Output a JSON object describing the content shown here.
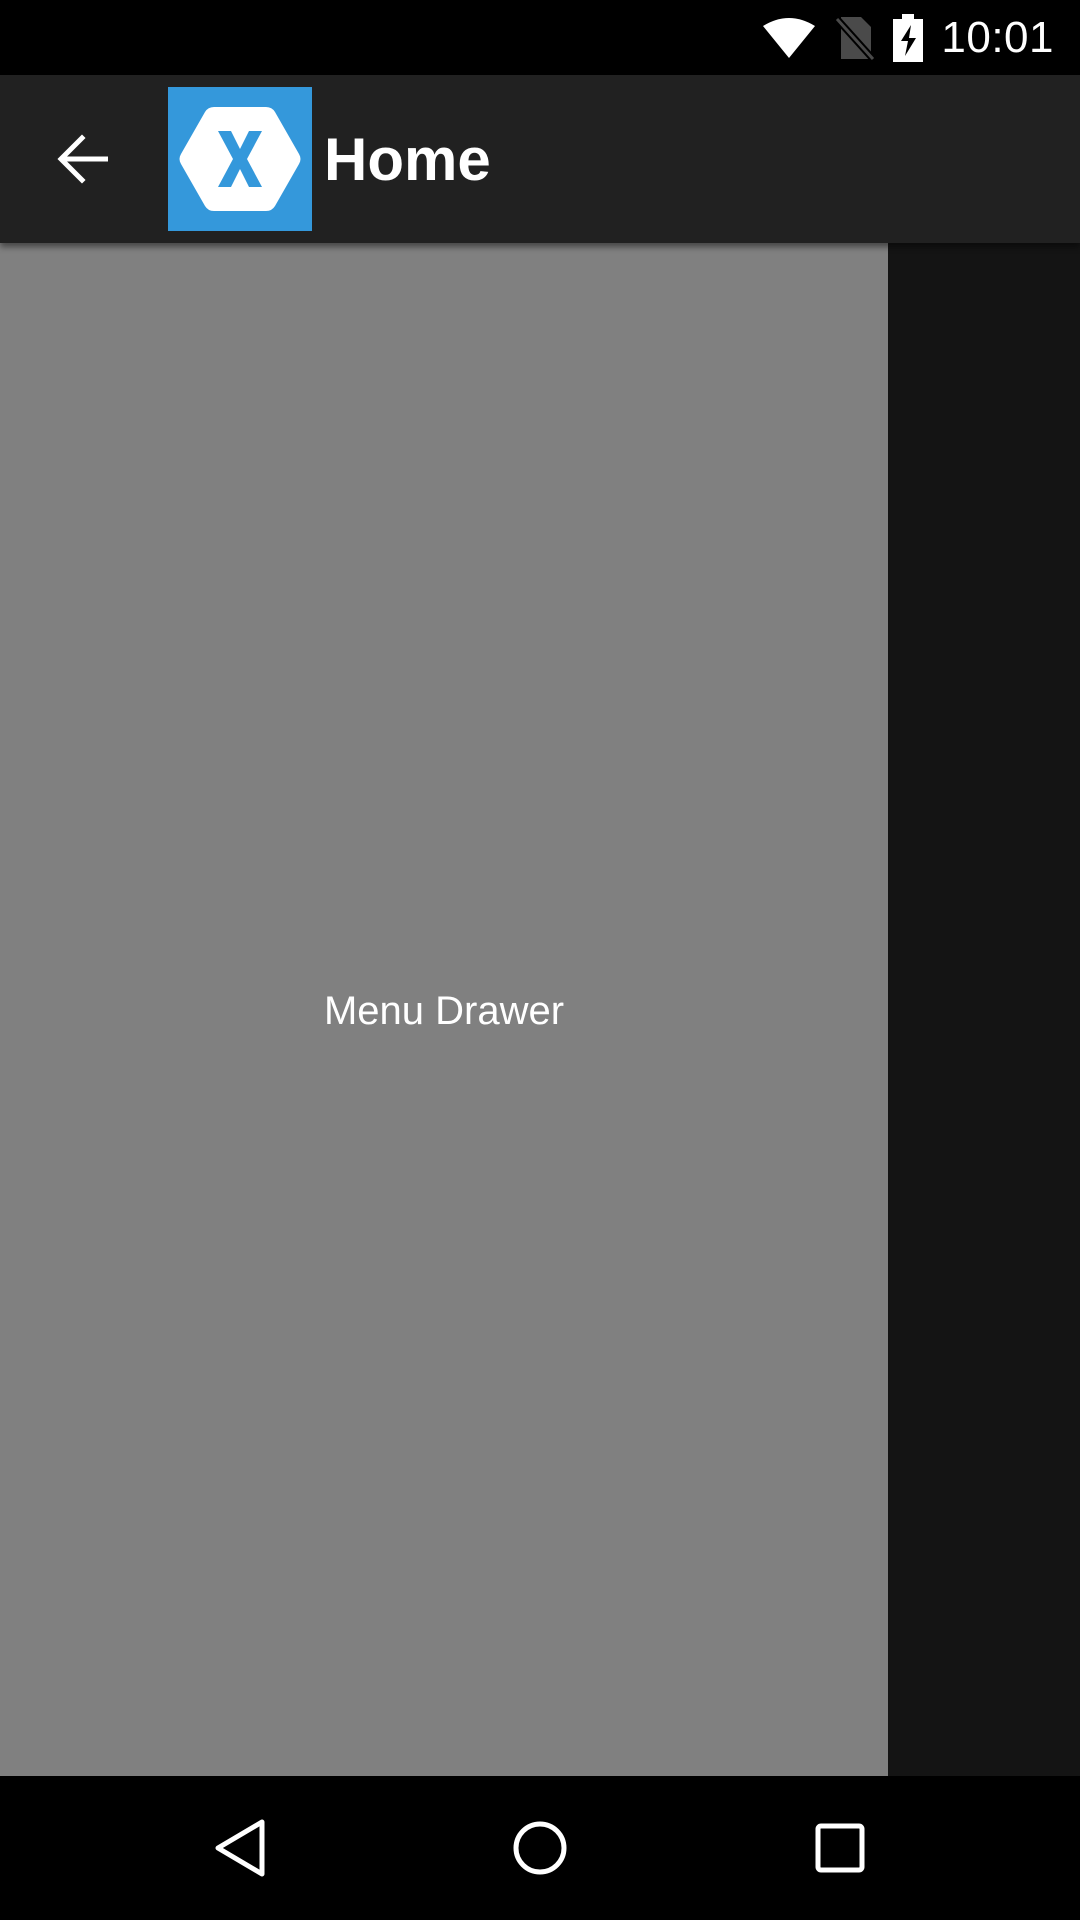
{
  "status_bar": {
    "time": "10:01",
    "icons": [
      "wifi-icon",
      "no-sim-icon",
      "battery-charging-icon"
    ]
  },
  "app_bar": {
    "title": "Home",
    "back_icon": "arrow-back-icon",
    "logo_icon": "xamarin-logo-icon",
    "logo_color": "#3498DB",
    "background_color": "#212121"
  },
  "drawer": {
    "label": "Menu Drawer",
    "background_color": "#808080"
  },
  "nav_bar": {
    "buttons": [
      "back-triangle-icon",
      "home-circle-icon",
      "recents-square-icon"
    ]
  }
}
